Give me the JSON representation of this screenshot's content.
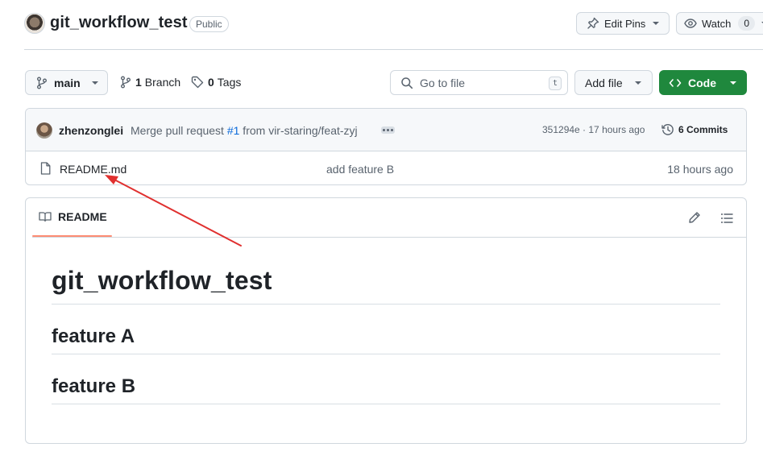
{
  "header": {
    "repo_name": "git_workflow_test",
    "visibility": "Public",
    "edit_pins_label": "Edit Pins",
    "watch_label": "Watch",
    "watch_count": "0"
  },
  "toolbar": {
    "branch_name": "main",
    "branches_count": "1",
    "branches_label": "Branch",
    "tags_count": "0",
    "tags_label": "Tags",
    "go_to_file_placeholder": "Go to file",
    "go_to_file_shortcut": "t",
    "add_file_label": "Add file",
    "code_label": "Code"
  },
  "latest_commit": {
    "author": "zhenzonglei",
    "message_prefix": "Merge pull request ",
    "pr_link": "#1",
    "message_suffix": " from vir-staring/feat-zyj",
    "sha_and_time": "351294e · 17 hours ago",
    "commits_label": "6 Commits"
  },
  "files": [
    {
      "name": "README.md",
      "last_commit": "add feature B",
      "age": "18 hours ago"
    }
  ],
  "readme": {
    "tab_label": "README",
    "h1": "git_workflow_test",
    "h2_a": "feature A",
    "h2_b": "feature B"
  },
  "colors": {
    "accent_green": "#1f883d",
    "link_blue": "#0969da",
    "tab_underline": "#fd8c73",
    "annotation_red": "#e0302f"
  },
  "icons": [
    "repo-avatar",
    "pin-icon",
    "eye-icon",
    "git-branch-icon",
    "tag-icon",
    "search-icon",
    "code-icon",
    "history-icon",
    "file-icon",
    "book-icon",
    "pencil-icon",
    "list-unordered-icon",
    "annotation-arrow"
  ]
}
